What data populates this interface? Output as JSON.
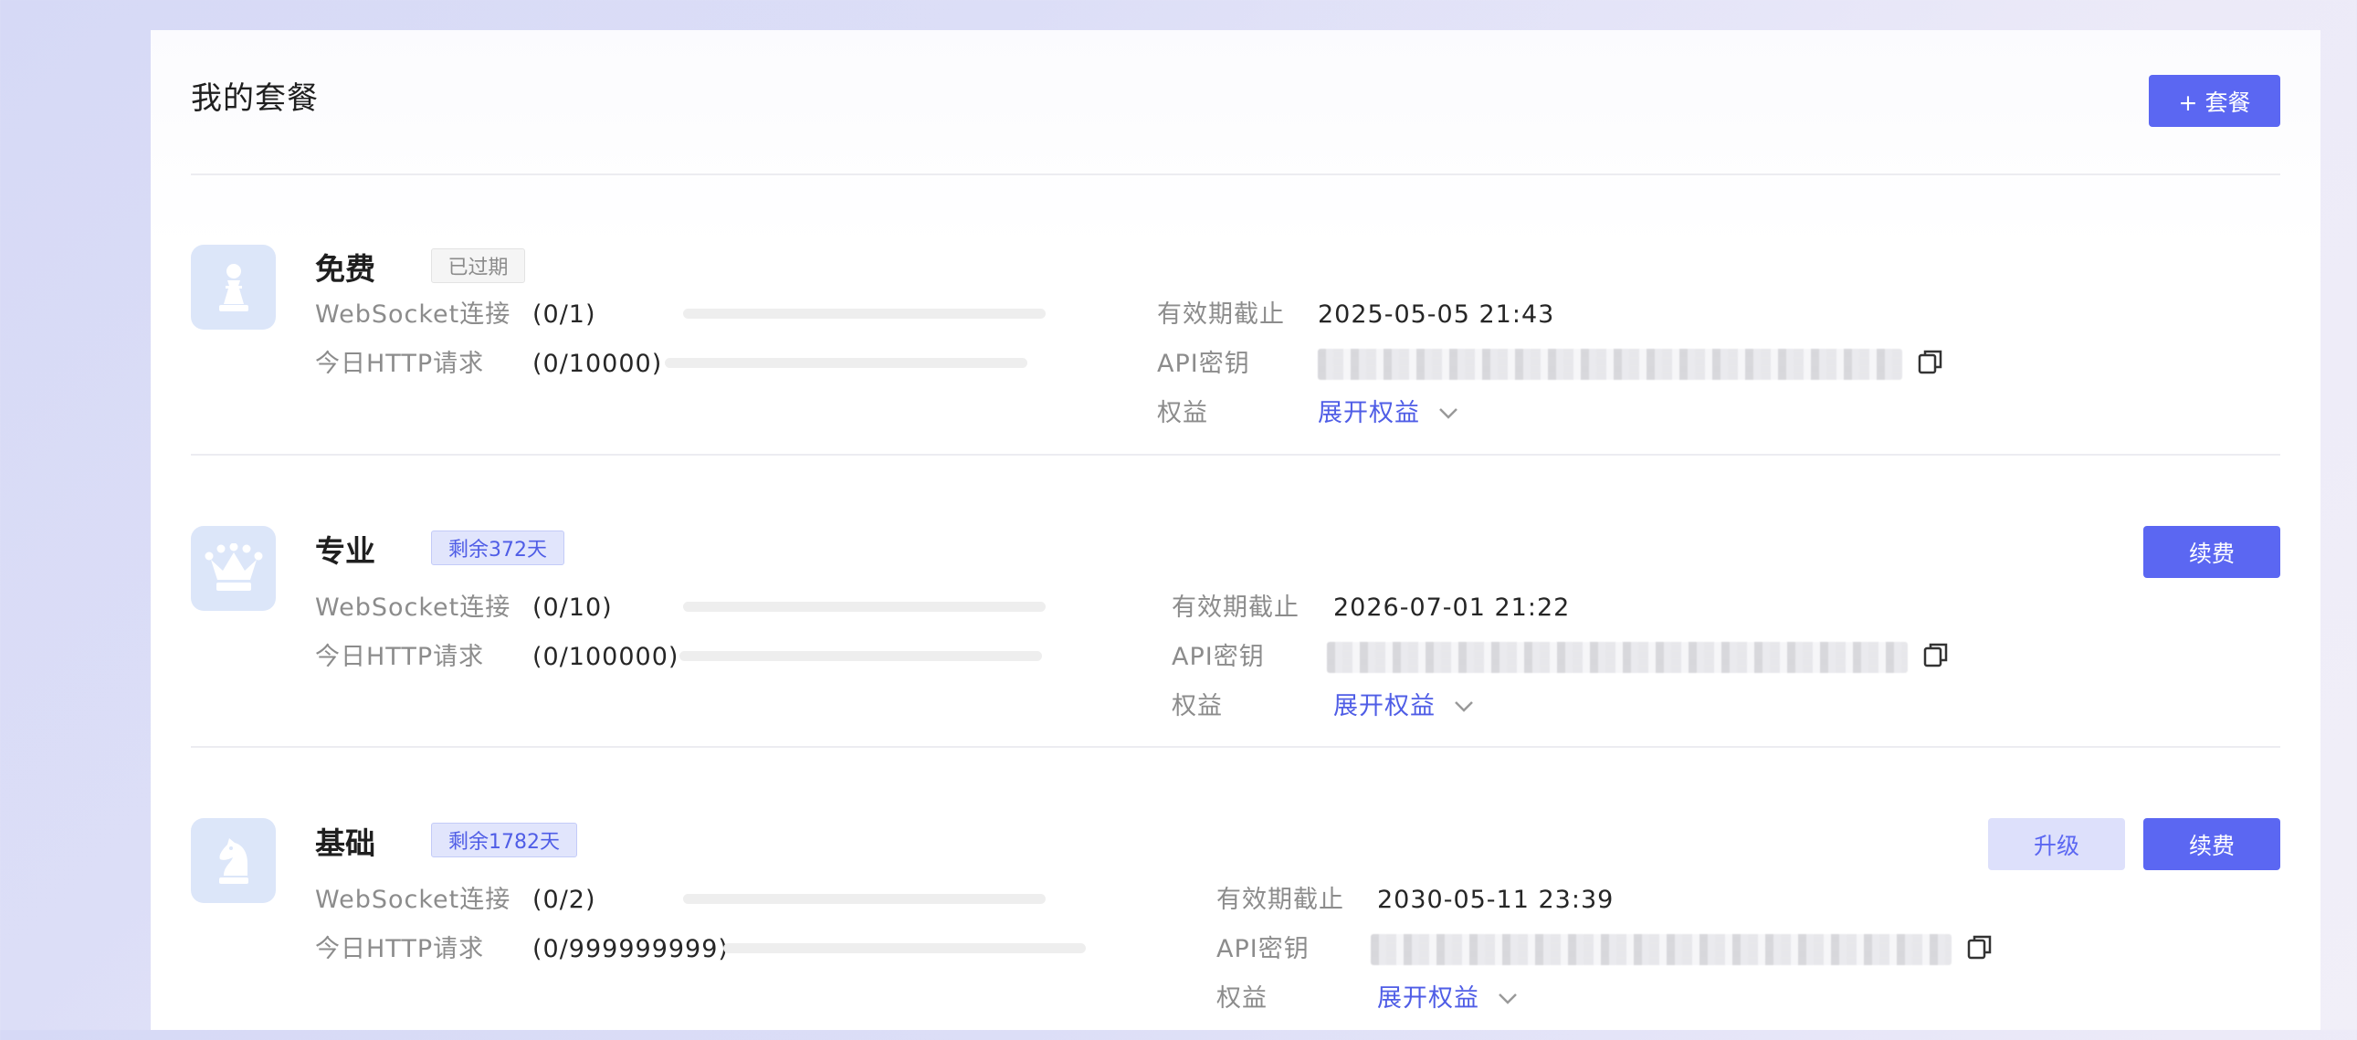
{
  "header": {
    "title": "我的套餐",
    "add_button": "+ 套餐"
  },
  "colors": {
    "primary": "#5b67f2",
    "primary_soft": "#dde0fb",
    "icon_bg": "#dce6f9"
  },
  "labels": {
    "websocket": "WebSocket连接",
    "http": "今日HTTP请求",
    "expiry": "有效期截止",
    "api_key": "API密钥",
    "benefits": "权益",
    "expand_benefits": "展开权益"
  },
  "plans": [
    {
      "name": "免费",
      "badge": "已过期",
      "badge_type": "expired",
      "icon": "chess-pawn-icon",
      "websocket_usage": "(0/1)",
      "websocket_ratio": 0,
      "http_usage": "(0/10000)",
      "http_ratio": 0,
      "expiry": "2025-05-05 21:43",
      "buttons": []
    },
    {
      "name": "专业",
      "badge": "剩余372天",
      "badge_type": "remain",
      "icon": "crown-icon",
      "websocket_usage": "(0/10)",
      "websocket_ratio": 0,
      "http_usage": "(0/100000)",
      "http_ratio": 0,
      "expiry": "2026-07-01 21:22",
      "buttons": [
        "续费"
      ]
    },
    {
      "name": "基础",
      "badge": "剩余1782天",
      "badge_type": "remain",
      "icon": "chess-knight-icon",
      "websocket_usage": "(0/2)",
      "websocket_ratio": 0,
      "http_usage": "(0/999999999)",
      "http_ratio": 0,
      "expiry": "2030-05-11 23:39",
      "buttons": [
        "升级",
        "续费"
      ]
    }
  ]
}
